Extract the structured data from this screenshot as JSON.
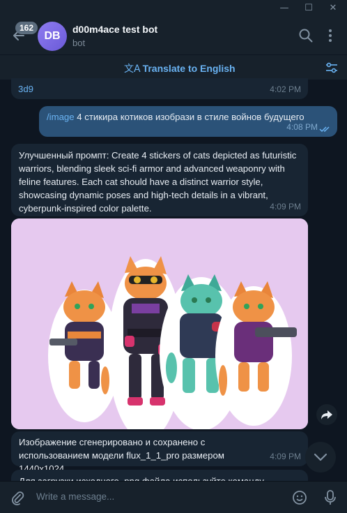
{
  "window": {
    "minimize_icon": "minimize-icon",
    "maximize_icon": "maximize-icon",
    "close_icon": "close-icon"
  },
  "header": {
    "unread_count": "162",
    "avatar_initials": "DB",
    "chat_name": "d00m4ace test bot",
    "chat_status": "bot"
  },
  "translate_bar": {
    "label": "Translate to English",
    "glyph": "文A"
  },
  "messages": [
    {
      "id": "m0",
      "direction": "in",
      "text": "3d9",
      "time": "4:02 PM"
    },
    {
      "id": "m1",
      "direction": "out",
      "command": "/image",
      "text": "4 стикира котиков изобрази в стиле войнов будущего",
      "time": "4:08 PM",
      "read": true
    },
    {
      "id": "m2",
      "direction": "in",
      "text": "Улучшенный промпт: Create 4 stickers of cats depicted as futuristic warriors, blending sleek sci-fi armor and advanced weaponry with feline features. Each cat should have a distinct warrior style, showcasing dynamic poses and high-tech details in a vibrant, cyberpunk-inspired color palette.",
      "time": "4:09 PM"
    },
    {
      "id": "m3",
      "direction": "in",
      "type": "image"
    },
    {
      "id": "m4",
      "direction": "in",
      "text": "Изображение сгенерировано и сохранено с использованием модели flux_1_1_pro размером 1440x1024.",
      "time": "4:09 PM"
    },
    {
      "id": "m5",
      "direction": "in",
      "text": "Для загрузки исходного .png файла используйте команду"
    }
  ],
  "composer": {
    "placeholder": "Write a message..."
  },
  "colors": {
    "background": "#0e1621",
    "panel": "#17212b",
    "bubble_in": "#182533",
    "bubble_out": "#2b5278",
    "accent": "#6ab3f3"
  }
}
